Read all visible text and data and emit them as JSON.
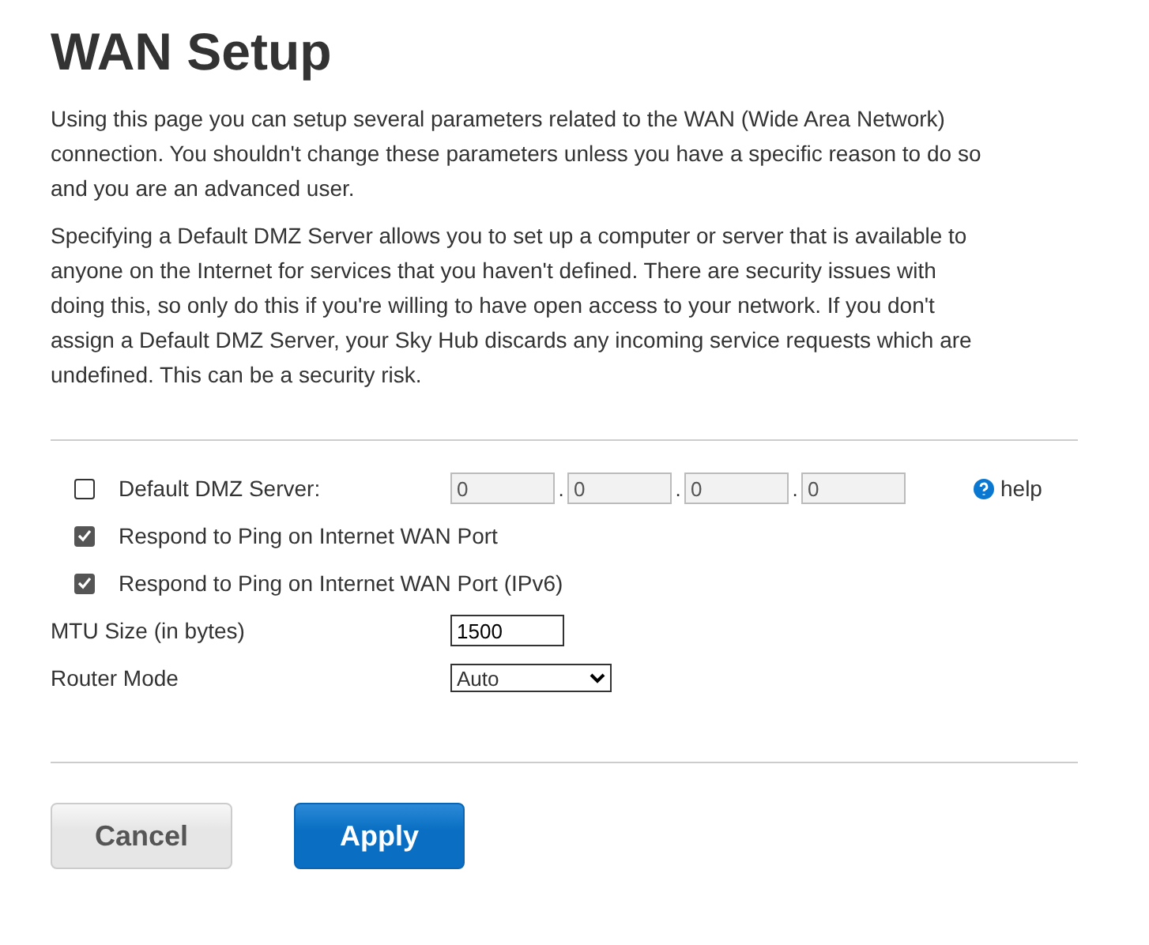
{
  "title": "WAN Setup",
  "paragraphs": [
    "Using this page you can setup several parameters related to the WAN (Wide Area Network) connection. You shouldn't change these parameters unless you have a specific reason to do so and you are an advanced user.",
    "Specifying a Default DMZ Server allows you to set up a computer or server that is available to anyone on the Internet for services that you haven't defined. There are security issues with doing this, so only do this if you're willing to have open access to your network. If you don't assign a Default DMZ Server, your Sky Hub discards any incoming service requests which are undefined. This can be a security risk."
  ],
  "settings": [
    {
      "kind": "dmz",
      "label": "Default DMZ Server:",
      "checked": false,
      "octets": [
        {
          "value": "0",
          "disabled": true
        },
        {
          "value": "0",
          "disabled": true
        },
        {
          "value": "0",
          "disabled": true
        },
        {
          "value": "0",
          "disabled": true
        }
      ],
      "separators": [
        ".",
        ".",
        "."
      ],
      "help": "help"
    },
    {
      "kind": "checkbox",
      "label": "Respond to Ping on Internet WAN Port",
      "checked": true
    },
    {
      "kind": "checkbox",
      "label": "Respond to Ping on Internet WAN Port (IPv6)",
      "checked": true
    },
    {
      "kind": "text",
      "label": "MTU Size (in bytes)",
      "value": "1500"
    },
    {
      "kind": "select",
      "label": "Router Mode",
      "value": "Auto"
    }
  ],
  "buttons": [
    {
      "label": "Cancel",
      "kind": "secondary"
    },
    {
      "label": "Apply",
      "kind": "primary"
    }
  ]
}
